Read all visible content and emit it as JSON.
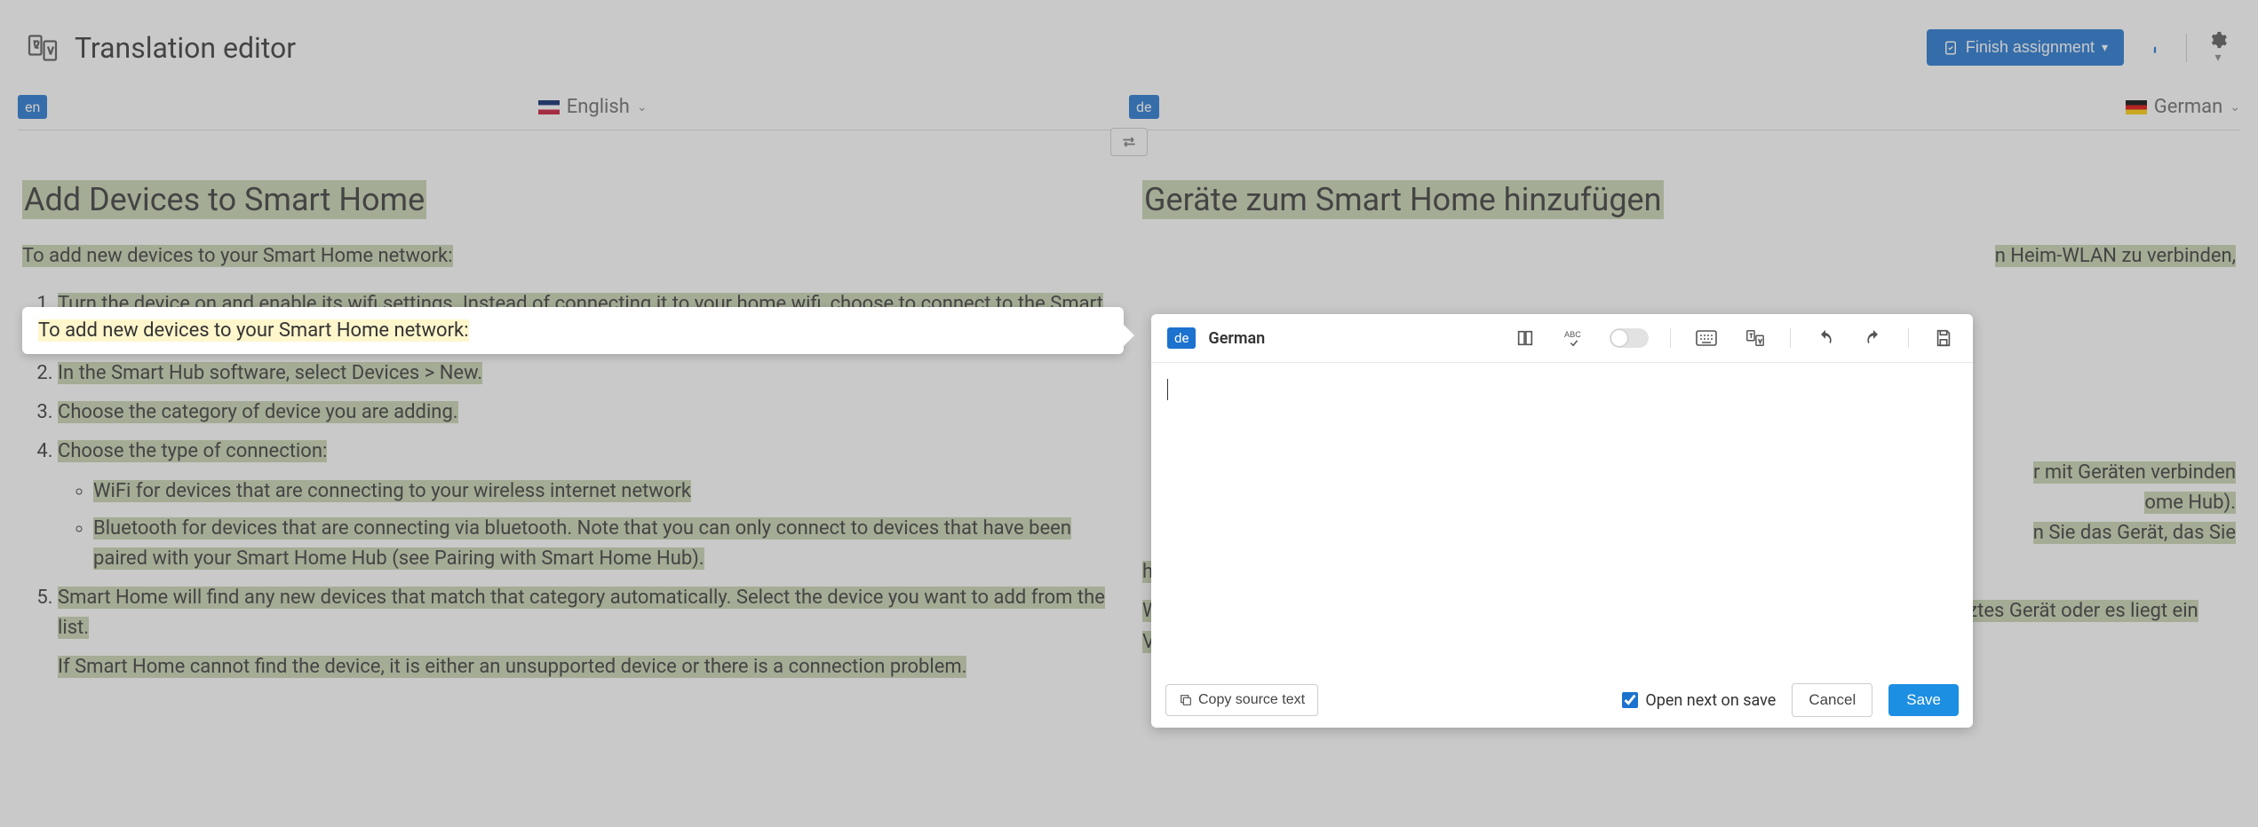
{
  "header": {
    "title": "Translation editor",
    "finish_button": "Finish assignment"
  },
  "languages": {
    "source": {
      "code": "en",
      "label": "English"
    },
    "target": {
      "code": "de",
      "label": "German"
    }
  },
  "source_doc": {
    "title": "Add Devices to Smart Home",
    "active_segment": "To add new devices to your Smart Home network:",
    "list": [
      "Turn the device on and enable its wifi settings. Instead of connecting it to your home wifi, choose to connect to the Smart Home wifi network.",
      "In the Smart Hub software, select Devices > New.",
      "Choose the category of device you are adding.",
      "Choose the type of connection:",
      "Smart Home will find any new devices that match that category automatically. Select the device you want to add from the list."
    ],
    "sublist": [
      "WiFi for devices that are connecting to your wireless internet network",
      "Bluetooth for devices that are connecting via bluetooth. Note that you can only connect to devices that have been paired with your Smart Home Hub (see Pairing with Smart Home Hub)."
    ],
    "tail": "If Smart Home cannot find the device, it is either an unsupported device or there is a connection problem."
  },
  "target_doc": {
    "title": "Geräte zum Smart Home hinzufügen",
    "frag_right": "n Heim-WLAN zu verbinden,",
    "frag_bullets": [
      "r mit Geräten verbinden",
      "ome Hub).",
      "n Sie das Gerät, das Sie"
    ],
    "visible": [
      "hinzufügen möchten, aus der Liste aus.",
      "Wenn Smart Home das Gerät nicht finden kann, handelt es sich entweder um ein nicht unterstütztes Gerät oder es liegt ein Verbindungsproblem vor."
    ]
  },
  "editor": {
    "badge": "de",
    "language": "German",
    "copy_source": "Copy source text",
    "open_next_label": "Open next on save",
    "open_next_checked": true,
    "cancel": "Cancel",
    "save": "Save"
  }
}
